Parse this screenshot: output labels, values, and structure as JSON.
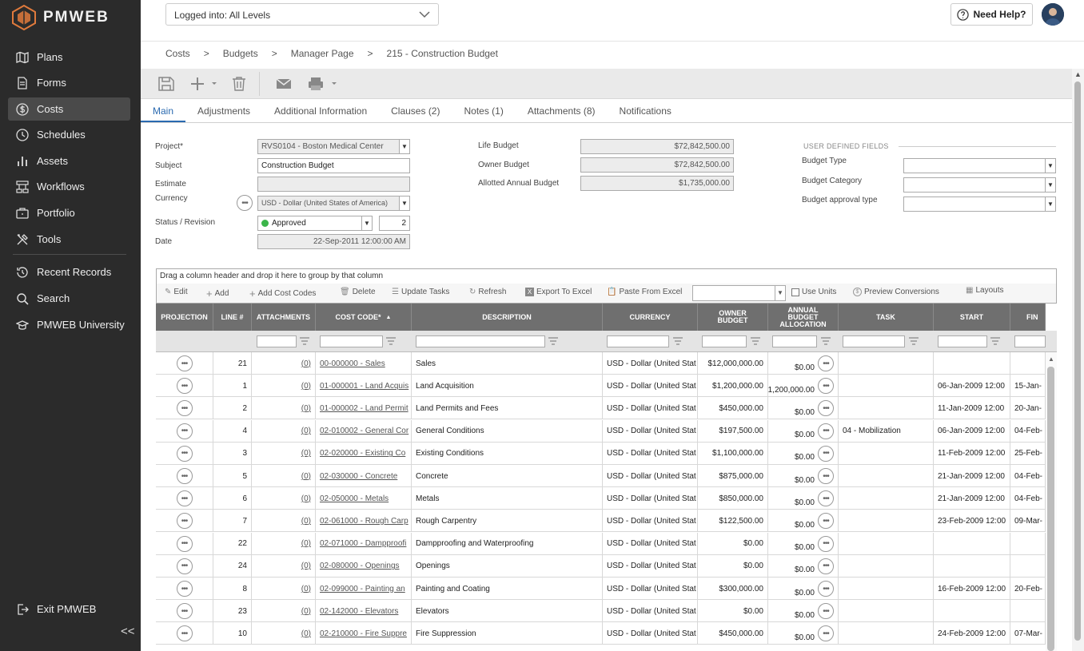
{
  "app": {
    "logo_text": "PMWEB"
  },
  "sidebar": {
    "items": [
      {
        "label": "Plans",
        "icon": "map-icon"
      },
      {
        "label": "Forms",
        "icon": "document-icon"
      },
      {
        "label": "Costs",
        "icon": "dollar-icon",
        "active": true
      },
      {
        "label": "Schedules",
        "icon": "clock-icon"
      },
      {
        "label": "Assets",
        "icon": "bar-chart-icon"
      },
      {
        "label": "Workflows",
        "icon": "workflow-icon"
      },
      {
        "label": "Portfolio",
        "icon": "briefcase-icon"
      },
      {
        "label": "Tools",
        "icon": "tools-icon"
      }
    ],
    "secondary": [
      {
        "label": "Recent Records",
        "icon": "history-icon"
      },
      {
        "label": "Search",
        "icon": "search-icon"
      },
      {
        "label": "PMWEB University",
        "icon": "graduation-cap-icon"
      }
    ],
    "exit_label": "Exit PMWEB",
    "collapse_label": "<<"
  },
  "header": {
    "login_select_value": "Logged into: All Levels",
    "help_label": "Need Help?"
  },
  "breadcrumb": [
    "Costs",
    "Budgets",
    "Manager Page",
    "215 - Construction Budget"
  ],
  "tabs": [
    "Main",
    "Adjustments",
    "Additional Information",
    "Clauses (2)",
    "Notes (1)",
    "Attachments (8)",
    "Notifications"
  ],
  "form": {
    "project_label": "Project*",
    "project_value": "RVS0104 - Boston Medical Center",
    "subject_label": "Subject",
    "subject_value": "Construction Budget",
    "estimate_label": "Estimate",
    "estimate_value": "",
    "currency_label": "Currency",
    "currency_value": "USD - Dollar (United States of America)",
    "status_label": "Status / Revision",
    "status_value": "Approved",
    "revision_value": "2",
    "date_label": "Date",
    "date_value": "22-Sep-2011 12:00:00 AM",
    "life_budget_label": "Life Budget",
    "life_budget_value": "$72,842,500.00",
    "owner_budget_label": "Owner Budget",
    "owner_budget_value": "$72,842,500.00",
    "allotted_label": "Allotted Annual Budget",
    "allotted_value": "$1,735,000.00",
    "udf_title": "USER DEFINED FIELDS",
    "budget_type_label": "Budget Type",
    "budget_category_label": "Budget Category",
    "budget_approval_label": "Budget approval type"
  },
  "grid": {
    "group_hint": "Drag a column header and drop it here to group by that column",
    "toolbar": {
      "edit": "Edit",
      "add": "Add",
      "add_cost_codes": "Add Cost Codes",
      "delete": "Delete",
      "update_tasks": "Update Tasks",
      "refresh": "Refresh",
      "export": "Export To Excel",
      "paste": "Paste From Excel",
      "use_units": "Use Units",
      "preview": "Preview Conversions",
      "layouts": "Layouts"
    },
    "columns": [
      "PROJECTION",
      "LINE #",
      "ATTACHMENTS",
      "COST CODE*",
      "DESCRIPTION",
      "CURRENCY",
      "OWNER BUDGET",
      "ANNUAL BUDGET ALLOCATION",
      "TASK",
      "START",
      "FIN"
    ],
    "rows": [
      {
        "line": "21",
        "att": "(0)",
        "code": "00-000000 - Sales",
        "desc": "Sales",
        "cur": "USD - Dollar (United Stat",
        "owner": "$12,000,000.00",
        "annual": "$0.00",
        "task": "",
        "start": "",
        "fin": ""
      },
      {
        "line": "1",
        "att": "(0)",
        "code": "01-000001 - Land Acquis",
        "desc": "Land Acquisition",
        "cur": "USD - Dollar (United Stat",
        "owner": "$1,200,000.00",
        "annual": "$1,200,000.00",
        "task": "",
        "start": "06-Jan-2009 12:00",
        "fin": "15-Jan-"
      },
      {
        "line": "2",
        "att": "(0)",
        "code": "01-000002 - Land Permit",
        "desc": "Land Permits and Fees",
        "cur": "USD - Dollar (United Stat",
        "owner": "$450,000.00",
        "annual": "$0.00",
        "task": "",
        "start": "11-Jan-2009 12:00",
        "fin": "20-Jan-"
      },
      {
        "line": "4",
        "att": "(0)",
        "code": "02-010002 - General Cor",
        "desc": "General Conditions",
        "cur": "USD - Dollar (United Stat",
        "owner": "$197,500.00",
        "annual": "$0.00",
        "task": "04 - Mobilization",
        "start": "06-Jan-2009 12:00",
        "fin": "04-Feb-"
      },
      {
        "line": "3",
        "att": "(0)",
        "code": "02-020000 - Existing Co",
        "desc": "Existing Conditions",
        "cur": "USD - Dollar (United Stat",
        "owner": "$1,100,000.00",
        "annual": "$0.00",
        "task": "",
        "start": "11-Feb-2009 12:00",
        "fin": "25-Feb-"
      },
      {
        "line": "5",
        "att": "(0)",
        "code": "02-030000 - Concrete",
        "desc": "Concrete",
        "cur": "USD - Dollar (United Stat",
        "owner": "$875,000.00",
        "annual": "$0.00",
        "task": "",
        "start": "21-Jan-2009 12:00",
        "fin": "04-Feb-"
      },
      {
        "line": "6",
        "att": "(0)",
        "code": "02-050000 - Metals",
        "desc": "Metals",
        "cur": "USD - Dollar (United Stat",
        "owner": "$850,000.00",
        "annual": "$0.00",
        "task": "",
        "start": "21-Jan-2009 12:00",
        "fin": "04-Feb-"
      },
      {
        "line": "7",
        "att": "(0)",
        "code": "02-061000 - Rough Carp",
        "desc": "Rough Carpentry",
        "cur": "USD - Dollar (United Stat",
        "owner": "$122,500.00",
        "annual": "$0.00",
        "task": "",
        "start": "23-Feb-2009 12:00",
        "fin": "09-Mar-"
      },
      {
        "line": "22",
        "att": "(0)",
        "code": "02-071000 - Dampproofi",
        "desc": "Dampproofing and Waterproofing",
        "cur": "USD - Dollar (United Stat",
        "owner": "$0.00",
        "annual": "$0.00",
        "task": "",
        "start": "",
        "fin": ""
      },
      {
        "line": "24",
        "att": "(0)",
        "code": "02-080000 - Openings",
        "desc": "Openings",
        "cur": "USD - Dollar (United Stat",
        "owner": "$0.00",
        "annual": "$0.00",
        "task": "",
        "start": "",
        "fin": ""
      },
      {
        "line": "8",
        "att": "(0)",
        "code": "02-099000 - Painting an",
        "desc": "Painting and Coating",
        "cur": "USD - Dollar (United Stat",
        "owner": "$300,000.00",
        "annual": "$0.00",
        "task": "",
        "start": "16-Feb-2009 12:00",
        "fin": "20-Feb-"
      },
      {
        "line": "23",
        "att": "(0)",
        "code": "02-142000 - Elevators",
        "desc": "Elevators",
        "cur": "USD - Dollar (United Stat",
        "owner": "$0.00",
        "annual": "$0.00",
        "task": "",
        "start": "",
        "fin": ""
      },
      {
        "line": "10",
        "att": "(0)",
        "code": "02-210000 - Fire Suppre",
        "desc": "Fire Suppression",
        "cur": "USD - Dollar (United Stat",
        "owner": "$450,000.00",
        "annual": "$0.00",
        "task": "",
        "start": "24-Feb-2009 12:00",
        "fin": "07-Mar-"
      }
    ]
  },
  "colors": {
    "sidebar_bg": "#2b2b2b",
    "sidebar_active": "#4a4a4a",
    "accent": "#2a6ab0",
    "grid_header": "#6f6f6f",
    "status_green": "#3bb54a",
    "logo_orange": "#e07a3c"
  }
}
